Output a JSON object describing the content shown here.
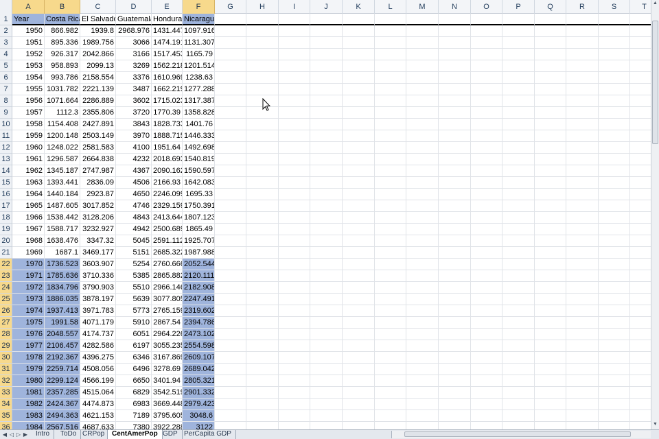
{
  "columns": [
    "A",
    "B",
    "C",
    "D",
    "E",
    "F",
    "G",
    "H",
    "I",
    "J",
    "K",
    "L",
    "M",
    "N",
    "O",
    "P",
    "Q",
    "R",
    "S",
    "T"
  ],
  "header_row": [
    "Year",
    "Costa Rica",
    "El Salvador",
    "Guatemala",
    "Honduras",
    "Nicaragua"
  ],
  "rows": [
    [
      "1950",
      "866.982",
      "1939.8",
      "2968.976",
      "1431.447",
      "1097.916"
    ],
    [
      "1951",
      "895.336",
      "1989.756",
      "3066",
      "1474.191",
      "1131.307"
    ],
    [
      "1952",
      "926.317",
      "2042.866",
      "3166",
      "1517.453",
      "1165.79"
    ],
    [
      "1953",
      "958.893",
      "2099.13",
      "3269",
      "1562.218",
      "1201.514"
    ],
    [
      "1954",
      "993.786",
      "2158.554",
      "3376",
      "1610.969",
      "1238.63"
    ],
    [
      "1955",
      "1031.782",
      "2221.139",
      "3487",
      "1662.219",
      "1277.288"
    ],
    [
      "1956",
      "1071.664",
      "2286.889",
      "3602",
      "1715.023",
      "1317.387"
    ],
    [
      "1957",
      "1112.3",
      "2355.806",
      "3720",
      "1770.39",
      "1358.828"
    ],
    [
      "1958",
      "1154.408",
      "2427.891",
      "3843",
      "1828.733",
      "1401.76"
    ],
    [
      "1959",
      "1200.148",
      "2503.149",
      "3970",
      "1888.715",
      "1446.333"
    ],
    [
      "1960",
      "1248.022",
      "2581.583",
      "4100",
      "1951.64",
      "1492.698"
    ],
    [
      "1961",
      "1296.587",
      "2664.838",
      "4232",
      "2018.693",
      "1540.819"
    ],
    [
      "1962",
      "1345.187",
      "2747.987",
      "4367",
      "2090.162",
      "1590.597"
    ],
    [
      "1963",
      "1393.441",
      "2836.09",
      "4506",
      "2166.93",
      "1642.083"
    ],
    [
      "1964",
      "1440.184",
      "2923.87",
      "4650",
      "2246.099",
      "1695.33"
    ],
    [
      "1965",
      "1487.605",
      "3017.852",
      "4746",
      "2329.159",
      "1750.391"
    ],
    [
      "1966",
      "1538.442",
      "3128.206",
      "4843",
      "2413.644",
      "1807.123"
    ],
    [
      "1967",
      "1588.717",
      "3232.927",
      "4942",
      "2500.689",
      "1865.49"
    ],
    [
      "1968",
      "1638.476",
      "3347.32",
      "5045",
      "2591.112",
      "1925.707"
    ],
    [
      "1969",
      "1687.1",
      "3469.177",
      "5151",
      "2685.322",
      "1987.988"
    ],
    [
      "1970",
      "1736.523",
      "3603.907",
      "5254",
      "2760.666",
      "2052.544"
    ],
    [
      "1971",
      "1785.636",
      "3710.336",
      "5385",
      "2865.882",
      "2120.111"
    ],
    [
      "1972",
      "1834.796",
      "3790.903",
      "5510",
      "2966.146",
      "2182.908"
    ],
    [
      "1973",
      "1886.035",
      "3878.197",
      "5639",
      "3077.805",
      "2247.491"
    ],
    [
      "1974",
      "1937.413",
      "3971.783",
      "5773",
      "2765.159",
      "2319.602"
    ],
    [
      "1975",
      "1991.58",
      "4071.179",
      "5910",
      "2867.54",
      "2394.786"
    ],
    [
      "1976",
      "2048.557",
      "4174.737",
      "6051",
      "2964.226",
      "2473.102"
    ],
    [
      "1977",
      "2106.457",
      "4282.586",
      "6197",
      "3055.235",
      "2554.598"
    ],
    [
      "1978",
      "2192.367",
      "4396.275",
      "6346",
      "3167.869",
      "2609.107"
    ],
    [
      "1979",
      "2259.714",
      "4508.056",
      "6496",
      "3278.69",
      "2689.042"
    ],
    [
      "1980",
      "2299.124",
      "4566.199",
      "6650",
      "3401.94",
      "2805.321"
    ],
    [
      "1981",
      "2357.285",
      "4515.064",
      "6829",
      "3542.519",
      "2901.332"
    ],
    [
      "1982",
      "2424.367",
      "4474.873",
      "6983",
      "3669.448",
      "2979.423"
    ],
    [
      "1983",
      "2494.363",
      "4621.153",
      "7189",
      "3795.605",
      "3048.6"
    ],
    [
      "1984",
      "2567.516",
      "4687.633",
      "7380",
      "3922.288",
      "3122"
    ]
  ],
  "selection": {
    "rows_from": 22,
    "rows_to": 36,
    "columns": [
      "A",
      "B",
      "F"
    ]
  },
  "sheet_tabs": [
    "Intro",
    "ToDo",
    "CRPop",
    "CentAmerPop",
    "GDP",
    "PerCapita GDP"
  ],
  "active_tab": "CentAmerPop",
  "colors": {
    "selection_fill": "#9fb4dc",
    "header_selected": "#f7d98c"
  }
}
